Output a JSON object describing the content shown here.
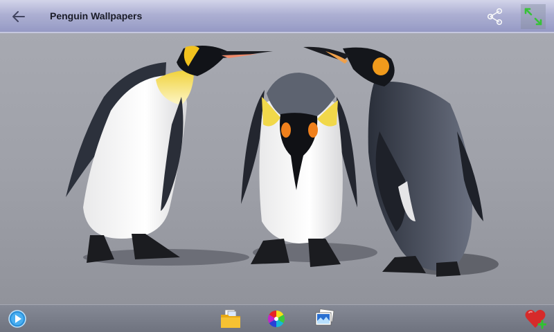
{
  "app": {
    "title": "Penguin Wallpapers"
  },
  "action_bar": {
    "back_icon": "back-arrow-icon",
    "share_icon": "share-icon",
    "fullscreen_icon": "fullscreen-toggle-icon"
  },
  "wallpaper": {
    "subject": "king-penguins-photo"
  },
  "bottom_bar": {
    "icons": [
      "slideshow-play-icon",
      "folder-icon",
      "color-wheel-icon",
      "gallery-images-icon",
      "favorite-heart-add-icon"
    ]
  },
  "colors": {
    "action_bar": "#aeb1d6",
    "bottom_bar": "#7b7f8b",
    "ground": "#9c9ea6",
    "accent_green": "#3cc83c",
    "heart_red": "#d62a2a"
  }
}
